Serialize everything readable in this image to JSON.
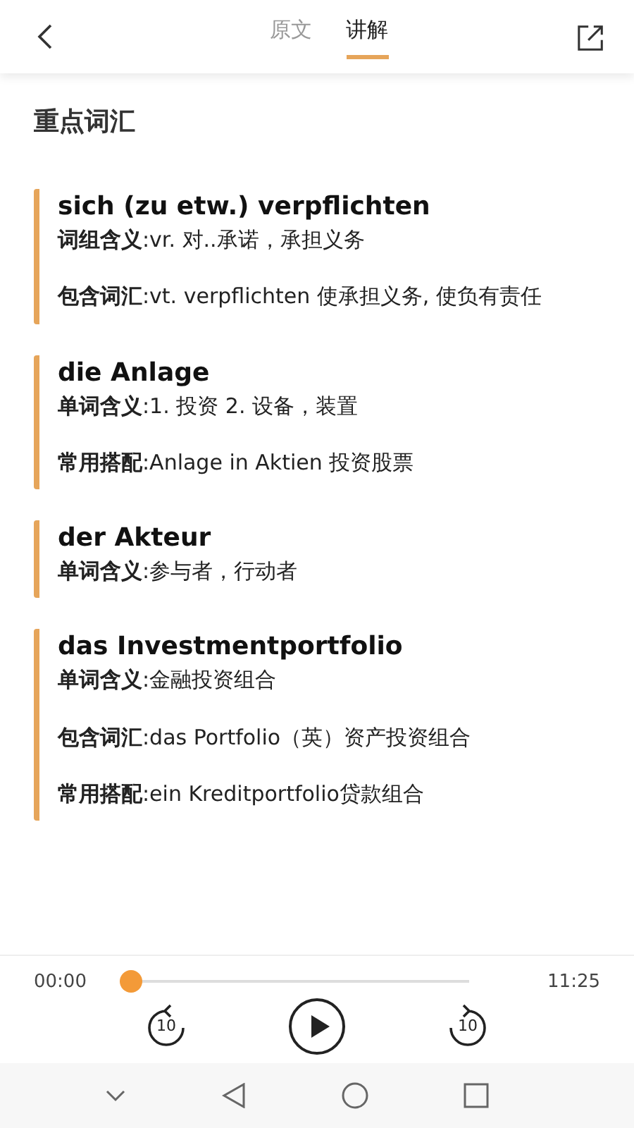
{
  "header": {
    "tabs": [
      {
        "label": "原文",
        "selected": false
      },
      {
        "label": "讲解",
        "selected": true
      }
    ]
  },
  "section_title": "重点词汇",
  "entries": [
    {
      "term": "sich (zu etw.) verpflichten",
      "lines": [
        "**词组含义**:vr. 对..承诺，承担义务",
        "**包含词汇**:vt. verpflichten 使承担义务, 使负有责任"
      ]
    },
    {
      "term": "die Anlage",
      "lines": [
        "**单词含义**:1. 投资 2. 设备，装置",
        "**常用搭配**:Anlage in Aktien 投资股票"
      ]
    },
    {
      "term": "der Akteur",
      "lines": [
        "**单词含义**:参与者，行动者"
      ]
    },
    {
      "term": "das Investmentportfolio",
      "lines": [
        "**单词含义**:金融投资组合",
        "**包含词汇**:das Portfolio（英）资产投资组合",
        "**常用搭配**:ein Kreditportfolio贷款组合"
      ]
    }
  ],
  "player": {
    "elapsed": "00:00",
    "duration": "11:25",
    "level": 0,
    "rewind_label": "10",
    "forward_label": "10"
  }
}
